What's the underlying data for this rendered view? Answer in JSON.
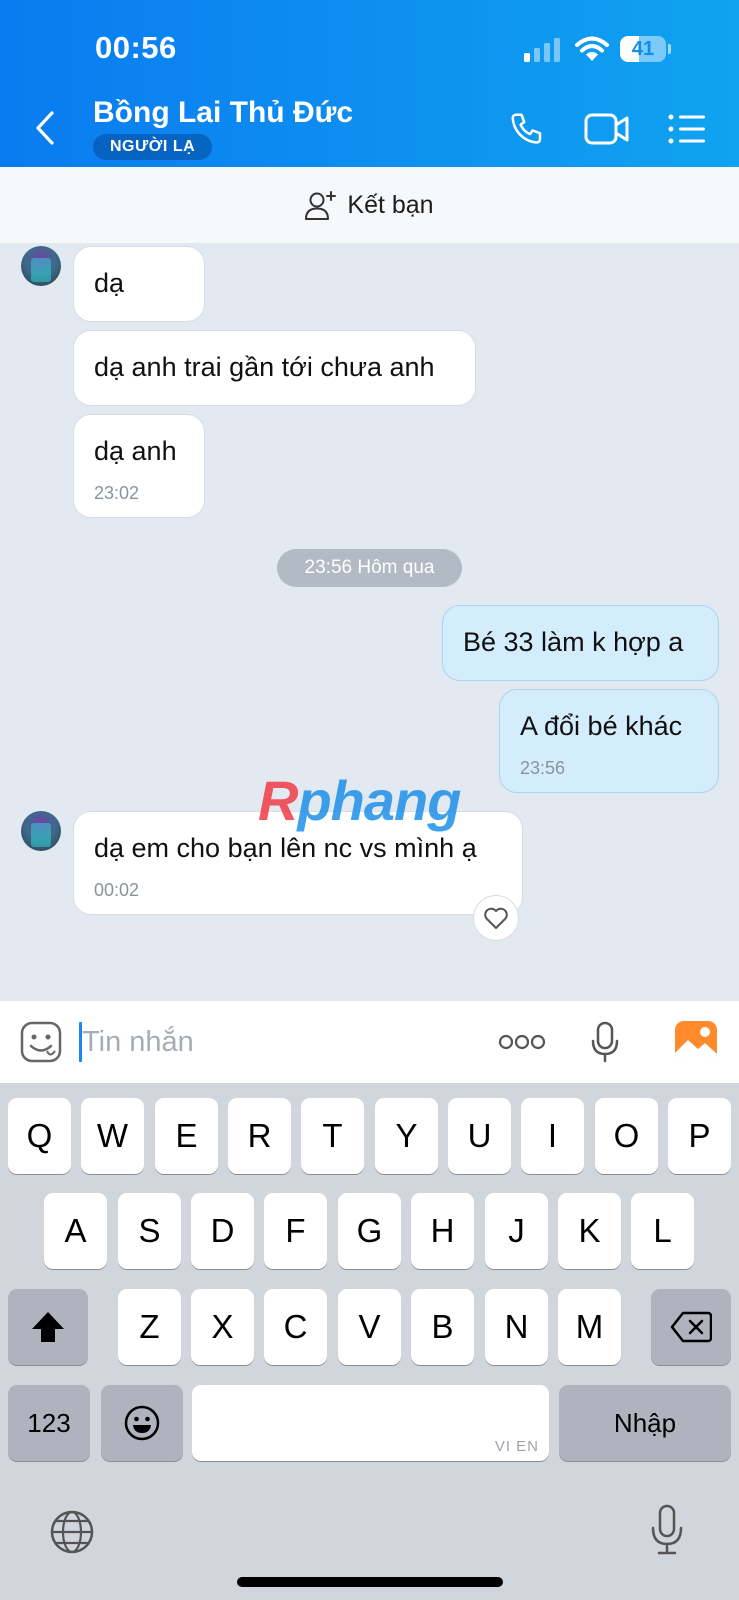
{
  "status_bar": {
    "time": "00:56",
    "battery": "41"
  },
  "header": {
    "contact_name": "Bồng Lai Thủ Đức",
    "badge": "NGƯỜI LẠ"
  },
  "friend_bar": {
    "label": "Kết bạn"
  },
  "messages": [
    {
      "side": "in",
      "text": "dạ"
    },
    {
      "side": "in",
      "text": "dạ anh trai gần tới chưa anh"
    },
    {
      "side": "in",
      "text": "dạ anh",
      "time": "23:02"
    },
    {
      "side": "out",
      "text": "Bé 33 làm k hợp a"
    },
    {
      "side": "out",
      "text": "A đổi bé khác",
      "time": "23:56"
    },
    {
      "side": "in",
      "text": "dạ em cho bạn lên nc vs mình ạ",
      "time": "00:02"
    }
  ],
  "day_separator": "23:56 Hôm qua",
  "watermark": "Rphang",
  "composer": {
    "placeholder": "Tin nhắn"
  },
  "keyboard": {
    "row1": [
      "Q",
      "W",
      "E",
      "R",
      "T",
      "Y",
      "U",
      "I",
      "O",
      "P"
    ],
    "row2": [
      "A",
      "S",
      "D",
      "F",
      "G",
      "H",
      "J",
      "K",
      "L"
    ],
    "row3": [
      "Z",
      "X",
      "C",
      "V",
      "B",
      "N",
      "M"
    ],
    "numbers": "123",
    "return": "Nhập",
    "space_hint": "VI EN"
  },
  "colors": {
    "header_start": "#0a7bf0",
    "header_end": "#10a3f0",
    "incoming": "#ffffff",
    "outgoing": "#d4edfd",
    "chat_bg": "#e2e9f1"
  }
}
